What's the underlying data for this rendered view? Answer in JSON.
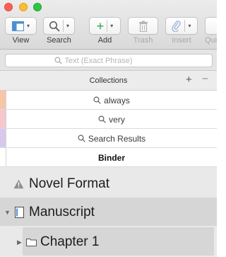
{
  "toolbar": {
    "view_label": "View",
    "search_label": "Search",
    "add_label": "Add",
    "trash_label": "Trash",
    "insert_label": "Insert",
    "quick_label": "Qui"
  },
  "search": {
    "placeholder": "Text (Exact Phrase)"
  },
  "collections": {
    "title": "Collections",
    "add_symbol": "+",
    "remove_symbol": "−",
    "items": [
      {
        "label": "always",
        "color": "#f6c6a6"
      },
      {
        "label": "very",
        "color": "#f4c8cc"
      },
      {
        "label": "Search Results",
        "color": "#d8c8ee"
      },
      {
        "label": "Binder",
        "color": "#ffffff"
      }
    ]
  },
  "binder": {
    "items": [
      {
        "label": "Novel Format",
        "icon": "warning-icon"
      },
      {
        "label": "Manuscript",
        "icon": "document-icon"
      },
      {
        "label": "Chapter 1",
        "icon": "folder-icon"
      }
    ]
  }
}
